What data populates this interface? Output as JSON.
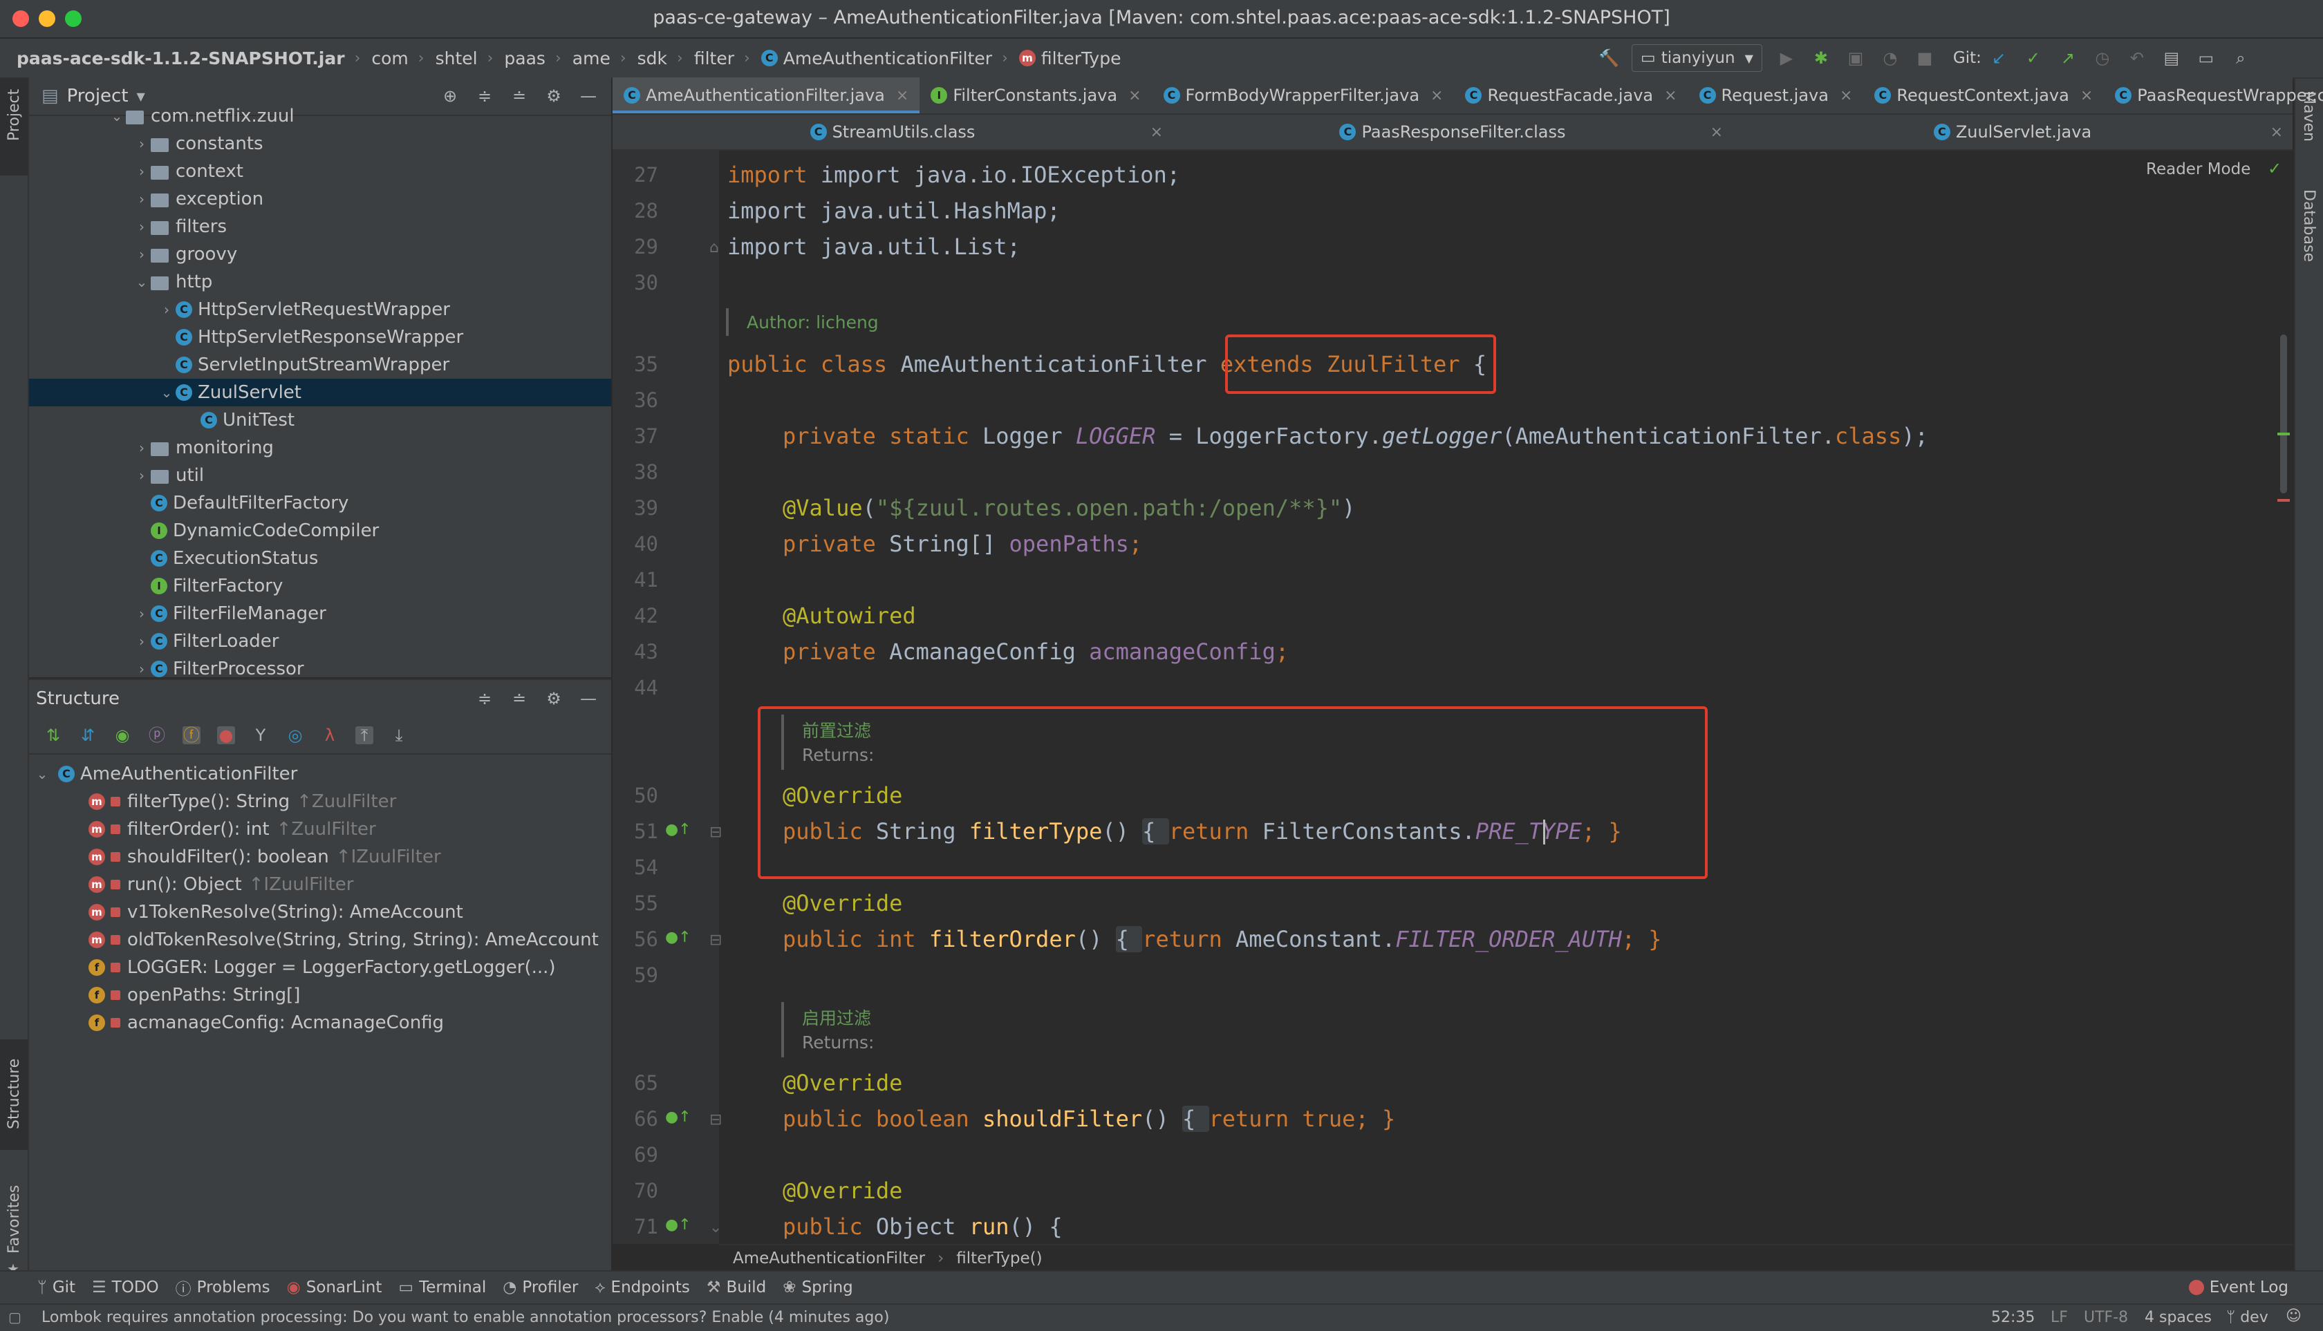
{
  "window": {
    "title": "paas-ce-gateway – AmeAuthenticationFilter.java [Maven: com.shtel.paas.ace:paas-ace-sdk:1.1.2-SNAPSHOT]"
  },
  "navbar": {
    "crumbs": [
      "paas-ace-sdk-1.1.2-SNAPSHOT.jar",
      "com",
      "shtel",
      "paas",
      "ame",
      "sdk",
      "filter",
      "AmeAuthenticationFilter",
      "filterType"
    ],
    "user": "tianyiyun",
    "git_label": "Git:"
  },
  "left_stripe": {
    "project": "Project",
    "structure": "Structure",
    "favorites": "Favorites"
  },
  "right_stripe": {
    "maven": "Maven",
    "database": "Database"
  },
  "project": {
    "header": "Project",
    "rows": [
      {
        "label": "com.netflix.zuul",
        "kind": "folder",
        "chev": "v"
      },
      {
        "label": "constants",
        "kind": "folder",
        "chev": ">"
      },
      {
        "label": "context",
        "kind": "folder",
        "chev": ">"
      },
      {
        "label": "exception",
        "kind": "folder",
        "chev": ">"
      },
      {
        "label": "filters",
        "kind": "folder",
        "chev": ">"
      },
      {
        "label": "groovy",
        "kind": "folder",
        "chev": ">"
      },
      {
        "label": "http",
        "kind": "folder",
        "chev": "v"
      },
      {
        "label": "HttpServletRequestWrapper",
        "kind": "class",
        "chev": ">"
      },
      {
        "label": "HttpServletResponseWrapper",
        "kind": "class",
        "chev": ""
      },
      {
        "label": "ServletInputStreamWrapper",
        "kind": "class",
        "chev": ""
      },
      {
        "label": "ZuulServlet",
        "kind": "class",
        "chev": "v"
      },
      {
        "label": "UnitTest",
        "kind": "class",
        "chev": ""
      },
      {
        "label": "monitoring",
        "kind": "folder",
        "chev": ">"
      },
      {
        "label": "util",
        "kind": "folder",
        "chev": ">"
      },
      {
        "label": "DefaultFilterFactory",
        "kind": "class",
        "chev": ""
      },
      {
        "label": "DynamicCodeCompiler",
        "kind": "interface",
        "chev": ""
      },
      {
        "label": "ExecutionStatus",
        "kind": "class",
        "chev": ""
      },
      {
        "label": "FilterFactory",
        "kind": "interface",
        "chev": ""
      },
      {
        "label": "FilterFileManager",
        "kind": "class",
        "chev": ">"
      },
      {
        "label": "FilterLoader",
        "kind": "class",
        "chev": ">"
      },
      {
        "label": "FilterProcessor",
        "kind": "class",
        "chev": ">"
      }
    ]
  },
  "structure": {
    "header": "Structure",
    "root": "AmeAuthenticationFilter",
    "members": [
      {
        "label": "filterType(): String",
        "inherit": "↑ZuulFilter",
        "kind": "m"
      },
      {
        "label": "filterOrder(): int",
        "inherit": "↑ZuulFilter",
        "kind": "m"
      },
      {
        "label": "shouldFilter(): boolean",
        "inherit": "↑IZuulFilter",
        "kind": "m"
      },
      {
        "label": "run(): Object",
        "inherit": "↑IZuulFilter",
        "kind": "m"
      },
      {
        "label": "v1TokenResolve(String): AmeAccount",
        "inherit": "",
        "kind": "m"
      },
      {
        "label": "oldTokenResolve(String, String, String): AmeAccount",
        "inherit": "",
        "kind": "m"
      },
      {
        "label": "LOGGER: Logger = LoggerFactory.getLogger(...)",
        "inherit": "",
        "kind": "f"
      },
      {
        "label": "openPaths: String[]",
        "inherit": "",
        "kind": "f"
      },
      {
        "label": "acmanageConfig: AcmanageConfig",
        "inherit": "",
        "kind": "f"
      }
    ]
  },
  "tabs_row1": [
    {
      "label": "AmeAuthenticationFilter.java",
      "active": true
    },
    {
      "label": "FilterConstants.java",
      "active": false
    },
    {
      "label": "FormBodyWrapperFilter.java",
      "active": false
    },
    {
      "label": "RequestFacade.java",
      "active": false
    },
    {
      "label": "Request.java",
      "active": false
    },
    {
      "label": "RequestContext.java",
      "active": false
    },
    {
      "label": "PaasRequestWrapper.class",
      "active": false
    }
  ],
  "tabs_row2": [
    {
      "label": "StreamUtils.class"
    },
    {
      "label": "PaasResponseFilter.class"
    },
    {
      "label": "ZuulServlet.java"
    }
  ],
  "editor": {
    "reader_mode": "Reader Mode",
    "line_numbers": [
      "27",
      "28",
      "29",
      "30",
      "35",
      "36",
      "37",
      "38",
      "39",
      "40",
      "41",
      "42",
      "43",
      "44",
      "50",
      "51",
      "54",
      "55",
      "56",
      "59",
      "65",
      "66",
      "69",
      "70",
      "71"
    ],
    "imports": [
      "import java.io.IOException;",
      "import java.util.HashMap;",
      "import java.util.List;"
    ],
    "author_doc": "Author: licheng",
    "class_decl": {
      "mods": "public class ",
      "name": "AmeAuthenticationFilter ",
      "ext": "extends ZuulFilter",
      "brace": " {"
    },
    "logger_line": {
      "mods": "private static ",
      "type": "Logger ",
      "field": "LOGGER",
      "rest1": " = LoggerFactory.",
      "call": "getLogger",
      "rest2": "(AmeAuthenticationFilter.",
      "cls": "class",
      "rest3": ");"
    },
    "value_ann": {
      "ann": "@Value",
      "open": "(",
      "str": "\"${zuul.routes.open.path:/open/**}\"",
      "close": ")"
    },
    "open_paths": {
      "mods": "private ",
      "type": "String[] ",
      "field": "openPaths",
      "semi": ";"
    },
    "autowired": "@Autowired",
    "acmanage": {
      "mods": "private ",
      "type": "AcmanageConfig ",
      "field": "acmanageConfig",
      "semi": ";"
    },
    "doc1_title": "前置过滤",
    "doc1_returns": "Returns:",
    "override": "@Override",
    "filter_type": {
      "mods": "public ",
      "type": "String ",
      "name": "filterType",
      "paren": "() ",
      "body1": "{ ",
      "ret": "return ",
      "cls": "FilterConstants.",
      "field": "PRE_TYPE",
      "end": "; }"
    },
    "filter_order": {
      "mods": "public int ",
      "name": "filterOrder",
      "paren": "() ",
      "body1": "{ ",
      "ret": "return ",
      "cls": "AmeConstant.",
      "field": "FILTER_ORDER_AUTH",
      "end": "; }"
    },
    "doc2_title": "启用过滤",
    "doc2_returns": "Returns:",
    "should_filter": {
      "mods": "public boolean ",
      "name": "shouldFilter",
      "paren": "() ",
      "body1": "{ ",
      "ret": "return true",
      "end": "; }"
    },
    "run_line": {
      "mods": "public ",
      "type": "Object ",
      "name": "run",
      "paren": "() {"
    }
  },
  "editor_breadcrumb": [
    "AmeAuthenticationFilter",
    "filterType()"
  ],
  "bottom_tools": [
    "Git",
    "TODO",
    "Problems",
    "SonarLint",
    "Terminal",
    "Profiler",
    "Endpoints",
    "Build",
    "Spring"
  ],
  "event_log": "Event Log",
  "status": {
    "message": "Lombok requires annotation processing: Do you want to enable annotation processors? Enable (4 minutes ago)",
    "position": "52:35",
    "line_sep": "LF",
    "encoding": "UTF-8",
    "indent": "4 spaces",
    "branch": "dev"
  },
  "colors": {
    "highlight_box": "#e03c2c",
    "keyword": "#cc7832",
    "annotation": "#bbb529",
    "string": "#6a8759",
    "field": "#9876aa",
    "method": "#ffc66d",
    "selection": "#0d293e"
  }
}
